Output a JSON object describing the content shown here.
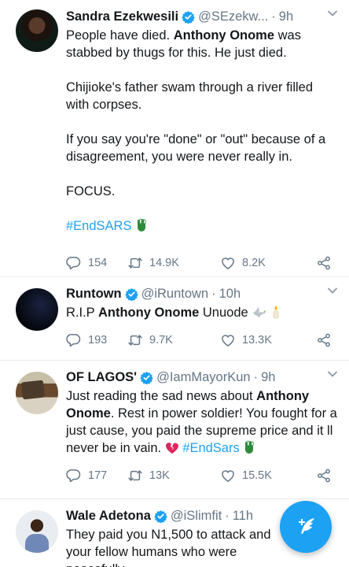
{
  "tweets": [
    {
      "name": "Sandra Ezekwesili",
      "handle": "@SEzekw...",
      "time": "9h",
      "lines": {
        "l1a": "People have died. ",
        "l1b": "Anthony Onome",
        "l1c": " was stabbed by thugs for this. He just died.",
        "l2": "Chijioke's father swam through a river filled with corpses.",
        "l3": "If you say you're \"done\" or \"out\" because of a disagreement, you were never really in.",
        "l4": "FOCUS.",
        "hashtag": "#EndSARS"
      },
      "replies": "154",
      "retweets": "14.9K",
      "likes": "8.2K"
    },
    {
      "name": "Runtown",
      "handle": "@iRuntown",
      "time": "10h",
      "lines": {
        "pre": "R.I.P ",
        "bold": "Anthony Onome",
        "post": " Unuode"
      },
      "replies": "193",
      "retweets": "9.7K",
      "likes": "13.3K"
    },
    {
      "name": "OF LAGOS'",
      "handle": "@IamMayorKun",
      "time": "9h",
      "lines": {
        "pre": "Just reading the sad news about ",
        "bold": "Anthony Onome",
        "post": ". Rest in power soldier! You fought for a just cause, you paid the supreme price and it ll never be in vain. ",
        "hashtag": "#EndSars"
      },
      "replies": "177",
      "retweets": "13K",
      "likes": "15.5K"
    },
    {
      "name": "Wale Adetona",
      "handle": "@iSlimfit",
      "time": "11h",
      "lines": {
        "text": "They paid you N1,500 to attack and your fellow humans who were peacefully"
      }
    }
  ],
  "icons": {
    "verified": "verified-badge-icon",
    "reply": "reply-icon",
    "retweet": "retweet-icon",
    "like": "heart-icon",
    "share": "share-icon",
    "compose": "compose-tweet-icon"
  },
  "colors": {
    "accent": "#1da1f2",
    "secondary_text": "#657786",
    "divider": "#e6ecf0"
  }
}
